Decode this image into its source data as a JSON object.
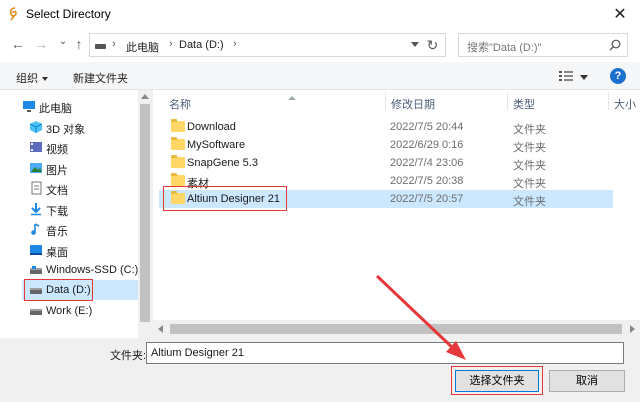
{
  "window": {
    "title": "Select Directory",
    "close_glyph": "✕"
  },
  "nav": {
    "back": "←",
    "forward": "→",
    "recent": "⌄",
    "up": "↑",
    "breadcrumb": [
      "此电脑",
      "Data (D:)"
    ],
    "sep": "›",
    "refresh": "↻",
    "search_placeholder": "搜索\"Data (D:)\""
  },
  "toolbar": {
    "organize": "组织",
    "new_folder": "新建文件夹",
    "help": "?"
  },
  "sidebar": {
    "items": [
      {
        "label": "此电脑",
        "icon": "computer-icon"
      },
      {
        "label": "3D 对象",
        "icon": "cube-icon"
      },
      {
        "label": "视频",
        "icon": "video-icon"
      },
      {
        "label": "图片",
        "icon": "picture-icon"
      },
      {
        "label": "文档",
        "icon": "document-icon"
      },
      {
        "label": "下载",
        "icon": "download-icon"
      },
      {
        "label": "音乐",
        "icon": "music-icon"
      },
      {
        "label": "桌面",
        "icon": "desktop-icon"
      },
      {
        "label": "Windows-SSD (C:)",
        "icon": "drive-icon"
      },
      {
        "label": "Data (D:)",
        "icon": "drive-icon",
        "selected": true
      },
      {
        "label": "Work (E:)",
        "icon": "drive-icon"
      }
    ]
  },
  "filelist": {
    "columns": {
      "name": "名称",
      "date": "修改日期",
      "type": "类型",
      "size": "大小"
    },
    "rows": [
      {
        "name": "Download",
        "date": "2022/7/5 20:44",
        "type": "文件夹"
      },
      {
        "name": "MySoftware",
        "date": "2022/6/29 0:16",
        "type": "文件夹"
      },
      {
        "name": "SnapGene 5.3",
        "date": "2022/7/4 23:06",
        "type": "文件夹"
      },
      {
        "name": "素材",
        "date": "2022/7/5 20:38",
        "type": "文件夹"
      },
      {
        "name": "Altium Designer 21",
        "date": "2022/7/5 20:57",
        "type": "文件夹",
        "selected": true
      }
    ]
  },
  "bottom": {
    "folder_label": "文件夹:",
    "folder_value": "Altium Designer 21",
    "select_button": "选择文件夹",
    "cancel_button": "取消"
  },
  "colors": {
    "selection": "#cce8ff",
    "annotation_red": "#e5383b",
    "folder_yellow": "#ffd766"
  }
}
